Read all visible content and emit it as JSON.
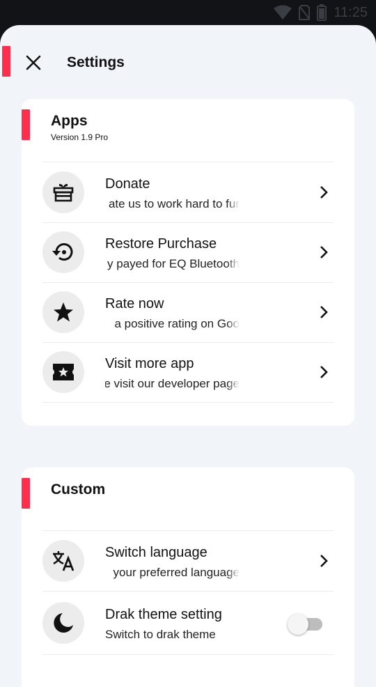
{
  "status_bar": {
    "time": "11:25",
    "icons": [
      "wifi-icon",
      "no-sim-icon",
      "battery-icon"
    ]
  },
  "header": {
    "title": "Settings",
    "close_icon": "close-icon"
  },
  "colors": {
    "accent": "#ff2e4c",
    "sheet_background": "#f1f4f9",
    "card_background": "#ffffff",
    "icon_circle": "#ececec",
    "toggle_off": "#bdbdbd"
  },
  "apps_section": {
    "title": "Apps",
    "subtitle": "Version 1.9 Pro",
    "items": [
      {
        "icon": "gift-icon",
        "title": "Donate",
        "subtitle": "ate us to work hard to fur"
      },
      {
        "icon": "restore-icon",
        "title": "Restore Purchase",
        "subtitle": "y payed for EQ Bluetooth"
      },
      {
        "icon": "star-icon",
        "title": "Rate now",
        "subtitle": "a positive rating on Goo"
      },
      {
        "icon": "ticket-icon",
        "title": "Visit more app",
        "subtitle": "e visit our developer page"
      }
    ]
  },
  "custom_section": {
    "title": "Custom",
    "items": [
      {
        "icon": "translate-icon",
        "title": "Switch language",
        "subtitle": "your preferred language"
      },
      {
        "icon": "moon-icon",
        "title": "Drak theme setting",
        "subtitle": "Switch to drak theme",
        "toggle_on": false
      }
    ]
  }
}
